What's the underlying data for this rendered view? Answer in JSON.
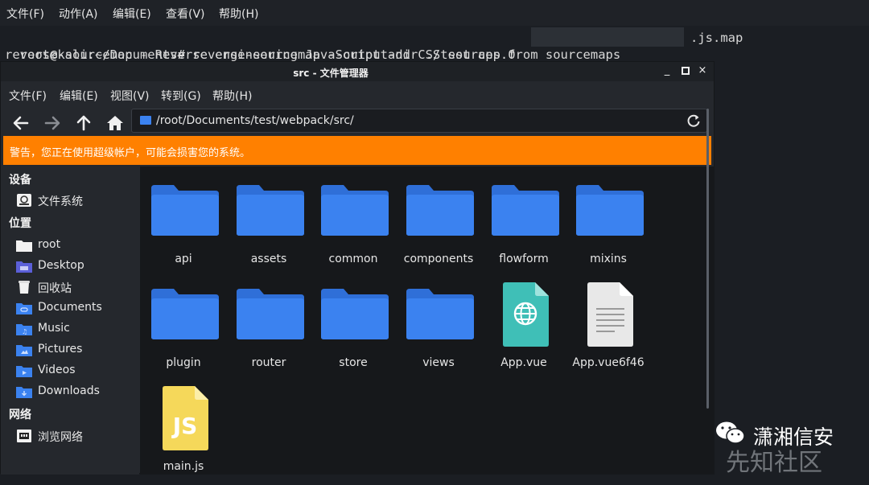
{
  "terminal": {
    "menu": [
      "文件(F)",
      "动作(A)",
      "编辑(E)",
      "查看(V)",
      "帮助(H)"
    ],
    "line1_prefix": "root@kali:~/Documents# reverse-sourcemap --output-dir ./test app.0",
    "line1_suffix": ".js.map",
    "line2": "reverse-sourcemap - Reverse engineering JavaScript and CSS sources from sourcemaps"
  },
  "window": {
    "title": "src - 文件管理器",
    "controls": [
      "_",
      "□",
      "×"
    ],
    "menu": [
      "文件(F)",
      "编辑(E)",
      "视图(V)",
      "转到(G)",
      "帮助(H)"
    ],
    "path": "/root/Documents/test/webpack/src/",
    "warning": "警告，您正在使用超级帐户，可能会损害您的系统。"
  },
  "sidebar": {
    "sections": [
      {
        "heading": "设备",
        "items": [
          {
            "label": "文件系统",
            "icon": "drive-icon"
          }
        ]
      },
      {
        "heading": "位置",
        "items": [
          {
            "label": "root",
            "icon": "home-folder-icon"
          },
          {
            "label": "Desktop",
            "icon": "desktop-folder-icon"
          },
          {
            "label": "回收站",
            "icon": "trash-icon"
          },
          {
            "label": "Documents",
            "icon": "documents-folder-icon"
          },
          {
            "label": "Music",
            "icon": "music-folder-icon"
          },
          {
            "label": "Pictures",
            "icon": "pictures-folder-icon"
          },
          {
            "label": "Videos",
            "icon": "videos-folder-icon"
          },
          {
            "label": "Downloads",
            "icon": "downloads-folder-icon"
          }
        ]
      },
      {
        "heading": "网络",
        "items": [
          {
            "label": "浏览网络",
            "icon": "network-icon"
          }
        ]
      }
    ]
  },
  "files": [
    {
      "name": "api",
      "type": "folder"
    },
    {
      "name": "assets",
      "type": "folder"
    },
    {
      "name": "common",
      "type": "folder"
    },
    {
      "name": "components",
      "type": "folder"
    },
    {
      "name": "flowform",
      "type": "folder"
    },
    {
      "name": "mixins",
      "type": "folder"
    },
    {
      "name": "plugin",
      "type": "folder"
    },
    {
      "name": "router",
      "type": "folder"
    },
    {
      "name": "store",
      "type": "folder"
    },
    {
      "name": "views",
      "type": "folder"
    },
    {
      "name": "App.vue",
      "type": "vue-file"
    },
    {
      "name": "App.vue6f46",
      "type": "text-file"
    },
    {
      "name": "main.js",
      "type": "js-file"
    }
  ],
  "watermark": {
    "brand": "潇湘信安",
    "site": "先知社区"
  },
  "colors": {
    "folder": "#3b82f0",
    "warning": "#ff8000",
    "vue_file": "#3fbfb7",
    "js_file": "#f5d85a"
  }
}
